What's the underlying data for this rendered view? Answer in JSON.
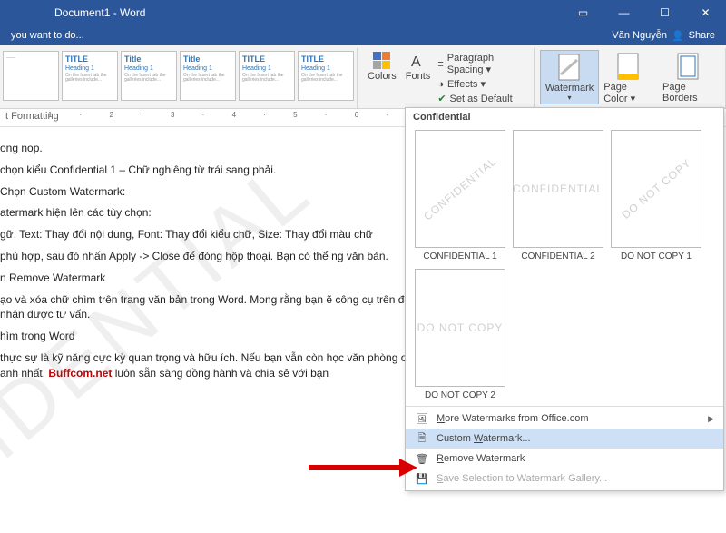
{
  "title": "Document1 - Word",
  "tell_me": "you want to do...",
  "user": "Văn Nguyễn",
  "share": "Share",
  "styles": [
    {
      "title": "",
      "h1": "",
      "note": "——"
    },
    {
      "title": "TITLE",
      "h1": "Heading 1",
      "note": "On the Insert tab the galleries include..."
    },
    {
      "title": "Title",
      "h1": "Heading 1",
      "note": "On the Insert tab the galleries include..."
    },
    {
      "title": "Title",
      "h1": "Heading 1",
      "note": "On the Insert tab the galleries include..."
    },
    {
      "title": "TITLE",
      "h1": "Heading 1",
      "note": "On the Insert tab the galleries include..."
    },
    {
      "title": "TITLE",
      "h1": "Heading 1",
      "note": "On the Insert tab the galleries include..."
    }
  ],
  "ribbon": {
    "colors": "Colors",
    "fonts": "Fonts",
    "para": "Paragraph Spacing ▾",
    "effects": "Effects ▾",
    "setdef": "Set as Default",
    "watermark": "Watermark",
    "pagecolor": "Page Color ▾",
    "borders": "Page Borders"
  },
  "formatting_label": "t Formatting",
  "doc": {
    "p0": "ong nop.",
    "p1": "chọn kiểu Confidential 1 – Chữ nghiêng từ trái sang phải.",
    "p2": "Chọn Custom Watermark:",
    "p3": "atermark hiện lên các tùy chọn:",
    "p4": "gữ, Text: Thay đổi nội dung, Font: Thay đổi kiểu chữ, Size: Thay đổi màu chữ",
    "p5": "phù hợp, sau đó nhấn Apply -> Close để đóng hộp thoại. Bạn có thể ng văn bản.",
    "p6": "n Remove Watermark",
    "p7": "ạo và xóa chữ chìm trên trang văn bản trong Word. Mong rằng bạn ẽ công cụ trên để thực hành vào công việc của mình. Nếu có gì khó ên dưới để nhận được tư vấn.",
    "p8": "hìm trong Word",
    "p9a": "thực sự là kỹ năng cực kỳ quan trọng và hữu ích. Nếu bạn vẫn còn học văn phòng online hay bất cứ thông tin liên quan, hãy",
    "p9b": "anh nhất.",
    "buffcom": "Buffcom.net",
    "p9c": " luôn sẵn sàng đồng hành và chia sẻ với bạn"
  },
  "wm_bg": "IDENTIAL",
  "dropdown": {
    "section": "Confidential",
    "items": [
      {
        "label": "CONFIDENTIAL 1",
        "wm": "CONFIDENTIAL"
      },
      {
        "label": "CONFIDENTIAL 2",
        "wm": "CONFIDENTIAL"
      },
      {
        "label": "DO NOT COPY 1",
        "wm": "DO NOT COPY"
      },
      {
        "label": "DO NOT COPY 2",
        "wm": "DO NOT COPY"
      }
    ],
    "menu": {
      "more": "More Watermarks from Office.com",
      "custom": "Custom Watermark...",
      "remove": "Remove Watermark",
      "save": "Save Selection to Watermark Gallery..."
    }
  }
}
